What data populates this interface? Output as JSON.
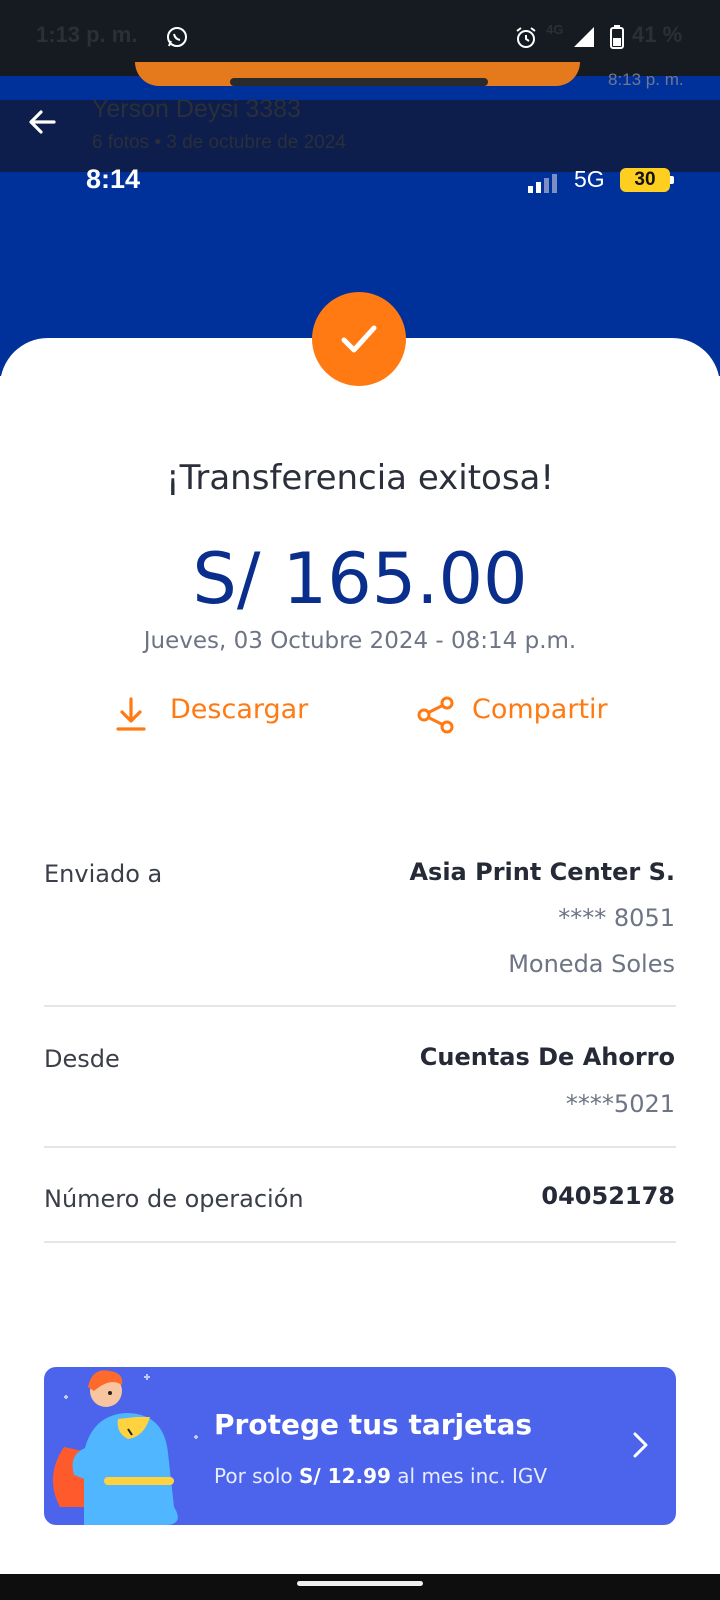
{
  "system_bar": {
    "time": "1:13 p. m.",
    "network": "4G",
    "battery": "41 %",
    "icons": [
      "whatsapp-icon",
      "alarm-icon",
      "signal-icon",
      "battery-icon"
    ]
  },
  "gallery": {
    "title": "Yerson Deysi 3383",
    "subtitle": "6 fotos  •  3 de octubre de 2024",
    "peek_time": "8:13 p. m.",
    "back_icon": "arrow-left-icon"
  },
  "phone_status": {
    "time": "8:14",
    "network": "5G",
    "battery": "30"
  },
  "receipt": {
    "title": "¡Transferencia exitosa!",
    "amount": "S/ 165.00",
    "datetime": "Jueves, 03 Octubre 2024 - 08:14 p.m.",
    "actions": {
      "download": "Descargar",
      "share": "Compartir"
    },
    "rows": {
      "sent_to": {
        "label": "Enviado a",
        "name": "Asia Print Center S.",
        "account": "**** 8051",
        "currency": "Moneda Soles"
      },
      "from": {
        "label": "Desde",
        "name": "Cuentas De Ahorro",
        "account": "****5021"
      },
      "operation": {
        "label": "Número de operación",
        "value": "04052178"
      }
    }
  },
  "promo": {
    "title": "Protege tus tarjetas",
    "sub_prefix": "Por solo ",
    "price": "S/ 12.99",
    "sub_suffix": " al mes inc. IGV"
  },
  "colors": {
    "brand_blue": "#00319b",
    "accent_orange": "#ff7a12",
    "promo_blue": "#4c64ec",
    "amount_blue": "#0a2e8c"
  }
}
